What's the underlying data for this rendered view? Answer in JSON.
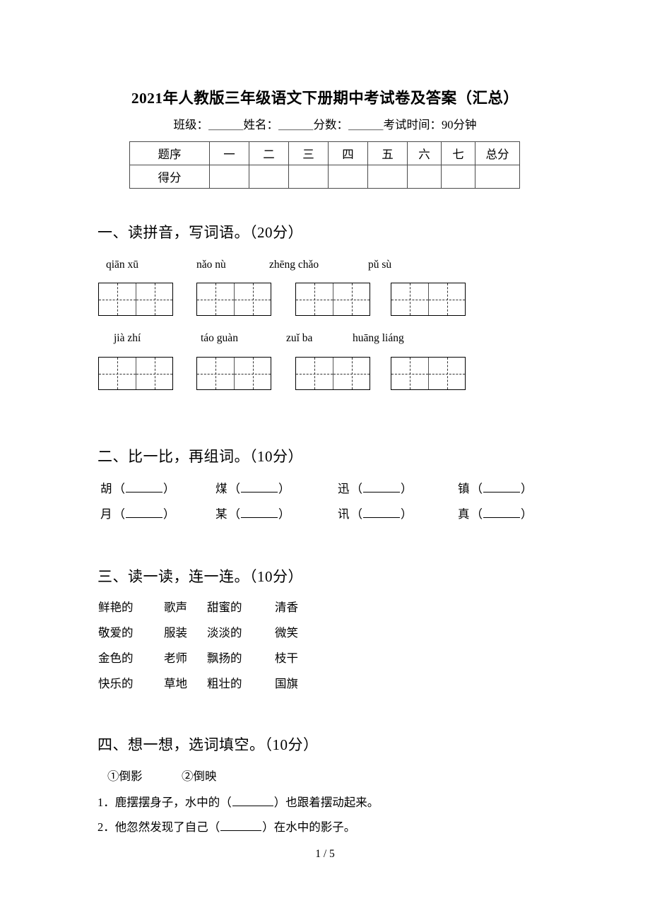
{
  "document": {
    "title": "2021年人教版三年级语文下册期中考试卷及答案（汇总）",
    "subtitle": "班级：＿＿＿姓名：＿＿＿分数：＿＿＿考试时间：90分钟",
    "footer": "1 / 5"
  },
  "score_table": {
    "row_labels": [
      "题序",
      "得分"
    ],
    "columns": [
      "一",
      "二",
      "三",
      "四",
      "五",
      "六",
      "七",
      "总分"
    ],
    "scores": [
      "",
      "",
      "",
      "",
      "",
      "",
      "",
      ""
    ]
  },
  "sections": [
    {
      "heading": "一、读拼音，写词语。（20分）",
      "rows": [
        [
          {
            "pinyin": "qiān xū",
            "cells": 2
          },
          {
            "pinyin": "nǎo nù",
            "cells": 2
          },
          {
            "pinyin": "zhēng chǎo",
            "cells": 2
          },
          {
            "pinyin": "pǔ sù",
            "cells": 2
          }
        ],
        [
          {
            "pinyin": "jià zhí",
            "cells": 2
          },
          {
            "pinyin": "táo guàn",
            "cells": 2
          },
          {
            "pinyin": "zuǐ ba",
            "cells": 2
          },
          {
            "pinyin": "huāng liáng",
            "cells": 2
          }
        ]
      ]
    },
    {
      "heading": "二、比一比，再组词。（10分）",
      "rows": [
        [
          "胡",
          "煤",
          "迅",
          "镇"
        ],
        [
          "月",
          "某",
          "讯",
          "真"
        ]
      ],
      "paren_left": "（",
      "paren_right": "）"
    },
    {
      "heading": "三、读一读，连一连。（10分）",
      "columns": [
        [
          "鲜艳的",
          "敬爱的",
          "金色的",
          "快乐的"
        ],
        [
          "歌声",
          "服装",
          "老师",
          "草地"
        ],
        [
          "甜蜜的",
          "淡淡的",
          "飘扬的",
          "粗壮的"
        ],
        [
          "清香",
          "微笑",
          "枝干",
          "国旗"
        ]
      ]
    },
    {
      "heading": "四、想一想，选词填空。（10分）",
      "options": [
        "①倒影",
        "②倒映"
      ],
      "questions": [
        {
          "prefix": "1．鹿摆摆身子，水中的（",
          "suffix": "）也跟着摆动起来。"
        },
        {
          "prefix": "2．他忽然发现了自己（",
          "suffix": "）在水中的影子。"
        }
      ]
    }
  ]
}
